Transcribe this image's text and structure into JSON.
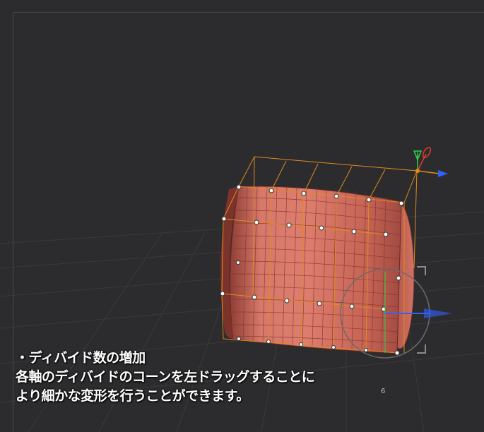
{
  "caption": {
    "title": "・ディバイド数の増加",
    "line1": "各軸のディバイドのコーンを左ドラッグすることに",
    "line2": "より細かな変形を行うことができます。"
  },
  "viewport": {
    "axis_number": "6"
  },
  "colors": {
    "background": "#2c2c2e",
    "object": "#d0685a",
    "lattice": "#e08a1e",
    "gizmo_x": "#2f63ff",
    "gizmo_y": "#2bd14a",
    "gizmo_z": "#e53a2a"
  },
  "icons": {
    "transform_gizmo": "move-gizmo-icon",
    "rotate_gizmo": "rotate-ring-icon"
  }
}
